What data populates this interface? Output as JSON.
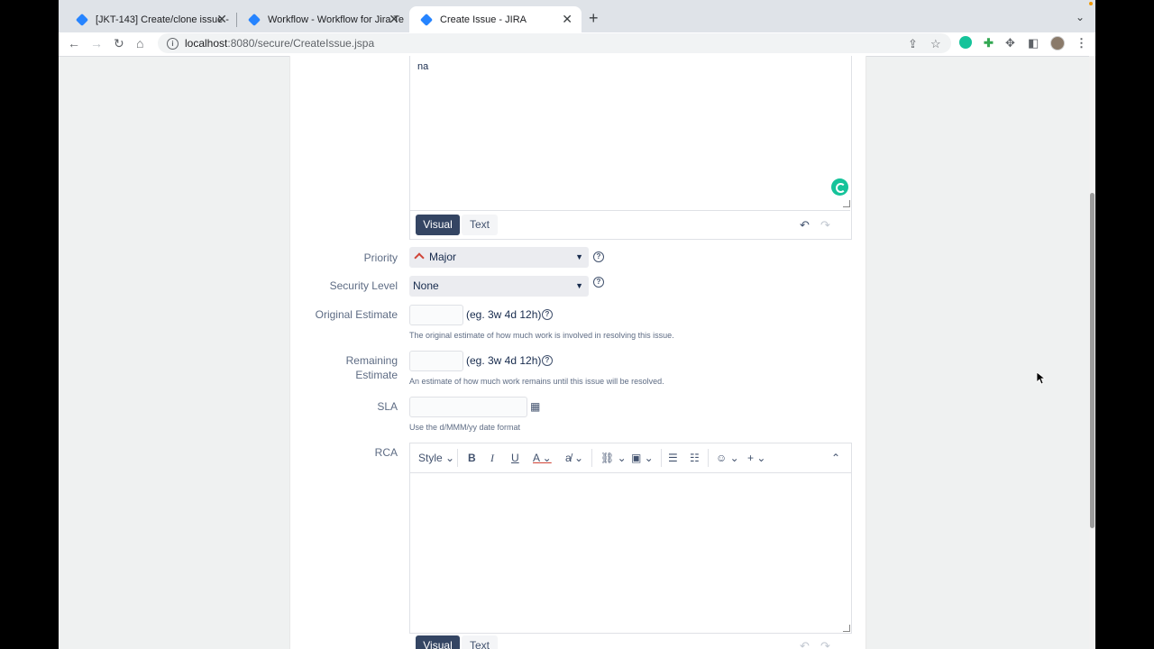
{
  "browser": {
    "tabs": [
      {
        "title": "[JKT-143] Create/clone issue -",
        "close": "✕"
      },
      {
        "title": "Workflow - Workflow for Jira Te",
        "close": "✕"
      },
      {
        "title": "Create Issue - JIRA",
        "close": "✕"
      }
    ],
    "new_tab": "+",
    "url_host": "localhost",
    "url_path": ":8080/secure/CreateIssue.jspa"
  },
  "description_editor": {
    "text": "na",
    "mode_visual": "Visual",
    "mode_text": "Text"
  },
  "fields": {
    "priority": {
      "label": "Priority",
      "value": "Major"
    },
    "security_level": {
      "label": "Security Level",
      "value": "None"
    },
    "original_estimate": {
      "label": "Original Estimate",
      "hint": "(eg. 3w 4d 12h)",
      "description": "The original estimate of how much work is involved in resolving this issue."
    },
    "remaining_estimate": {
      "label_line1": "Remaining",
      "label_line2": "Estimate",
      "hint": "(eg. 3w 4d 12h)",
      "description": "An estimate of how much work remains until this issue will be resolved."
    },
    "sla": {
      "label": "SLA",
      "description": "Use the d/MMM/yy date format"
    },
    "rca": {
      "label": "RCA",
      "style_label": "Style",
      "mode_visual": "Visual",
      "mode_text": "Text"
    }
  },
  "colors": {
    "visual_button": "#344563",
    "priority_major": "#d04437",
    "jira_blue": "#2684ff",
    "grammarly": "#15c39a"
  }
}
